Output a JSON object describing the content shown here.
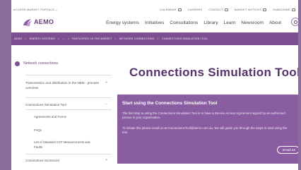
{
  "utility_bar": {
    "portal": "ACCESS MARKET PORTALS",
    "links": [
      "CALENDAR",
      "CAREERS",
      "CONTACT",
      "MARKET NOTICES",
      "SUBSCRIBE"
    ]
  },
  "header": {
    "logo": "AEMO",
    "nav": [
      "Energy systems",
      "Initiatives",
      "Consultations",
      "Library",
      "Learn",
      "Newsroom",
      "About"
    ]
  },
  "breadcrumb": [
    "AEMO",
    "ENERGY SYSTEMS",
    "...",
    "PARTICIPATE IN THE MARKET",
    "NETWORK CONNECTIONS",
    "CONNECTIONS SIMULATION TOOL"
  ],
  "sidebar": {
    "heading": "Network connections",
    "items": [
      {
        "label": "Transmission and distribution in the NEM - process overview",
        "chevron": "+"
      },
      {
        "label": "Connections Simulation Tool",
        "chevron": "−"
      },
      {
        "label": "Connections Scorecard",
        "chevron": "+"
      }
    ],
    "subitems": [
      "Agreements and Forms",
      "FAQs",
      "List of Standard CST Measurements and Faults"
    ]
  },
  "page_title": "Connections Simulation Tool",
  "panel": {
    "title": "Start using the Connections Simulation Tool",
    "p1": "The first step to using the Connections Simulation Tool is to have a Service Access Agreement signed by an authorised person in your organisation.",
    "p2": "To initiate this please email us at ConnectionsTool@aemo.com.au. We will guide you through the steps to start using the tool.",
    "button": "Email us"
  }
}
